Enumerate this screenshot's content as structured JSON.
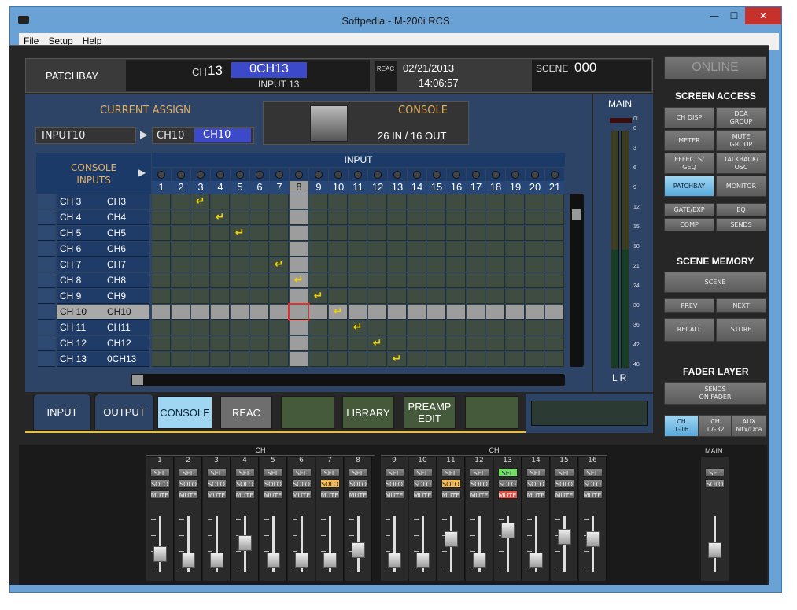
{
  "window": {
    "title": "Softpedia - M-200i RCS",
    "min": "—",
    "max": "☐",
    "close": "✕"
  },
  "menu": [
    "File",
    "Setup",
    "Help"
  ],
  "header": {
    "patchbay": "PATCHBAY",
    "ch_label": "CH",
    "ch_num": "13",
    "ch_name": "0CH13",
    "input_name": "INPUT 13",
    "reac": "REAC",
    "date": "02/21/2013",
    "time": "14:06:57",
    "scene_label": "SCENE",
    "scene_num": "000"
  },
  "assign": {
    "current_assign": "CURRENT ASSIGN",
    "source": "INPUT10",
    "dest_ch": "CH10",
    "dest_name": "CH10",
    "console": "CONSOLE",
    "io": "26 IN / 16 OUT"
  },
  "grid": {
    "row_title": "CONSOLE\nINPUTS",
    "input_title": "INPUT",
    "columns": [
      "1",
      "2",
      "3",
      "4",
      "5",
      "6",
      "7",
      "8",
      "9",
      "10",
      "11",
      "12",
      "13",
      "14",
      "15",
      "16",
      "17",
      "18",
      "19",
      "20",
      "21"
    ],
    "rows": [
      {
        "ch": "CH 3",
        "name": "CH3",
        "patch": 3
      },
      {
        "ch": "CH 4",
        "name": "CH4",
        "patch": 4
      },
      {
        "ch": "CH 5",
        "name": "CH5",
        "patch": 5
      },
      {
        "ch": "CH 6",
        "name": "CH6",
        "patch": 0
      },
      {
        "ch": "CH 7",
        "name": "CH7",
        "patch": 7
      },
      {
        "ch": "CH 8",
        "name": "CH8",
        "patch": 8
      },
      {
        "ch": "CH 9",
        "name": "CH9",
        "patch": 9
      },
      {
        "ch": "CH 10",
        "name": "CH10",
        "patch": 10
      },
      {
        "ch": "CH 11",
        "name": "CH11",
        "patch": 11
      },
      {
        "ch": "CH 12",
        "name": "CH12",
        "patch": 12
      },
      {
        "ch": "CH 13",
        "name": "0CH13",
        "patch": 13
      }
    ],
    "selected_row": "CH 10",
    "selected_col": "8",
    "arrow_glyph": "↵"
  },
  "meter": {
    "title": "MAIN",
    "ol": "0L",
    "scale": [
      "0",
      "3",
      "6",
      "9",
      "12",
      "15",
      "18",
      "21",
      "24",
      "30",
      "36",
      "42",
      "48"
    ],
    "lr": "L R"
  },
  "tabs": [
    "INPUT",
    "OUTPUT",
    "CONSOLE",
    "REAC",
    "",
    "LIBRARY",
    "PREAMP\nEDIT",
    ""
  ],
  "right": {
    "online": "ONLINE",
    "screen_access": "SCREEN ACCESS",
    "access_buttons": [
      "CH DISP",
      "DCA\nGROUP",
      "METER",
      "MUTE\nGROUP",
      "EFFECTS/\nGEQ",
      "TALKBACK/\nOSC",
      "PATCHBAY",
      "MONITOR",
      "GATE/EXP",
      "EQ",
      "COMP",
      "SENDS"
    ],
    "scene_memory": "SCENE MEMORY",
    "scene": "SCENE",
    "prev": "PREV",
    "next": "NEXT",
    "recall": "RECALL",
    "store": "STORE",
    "fader_layer": "FADER LAYER",
    "sends_on_fader": "SENDS\nON FADER",
    "layers": [
      "CH\n1-16",
      "CH\n17-32",
      "AUX\nMtx/Dca"
    ]
  },
  "mixer": {
    "group_label": "CH",
    "main_label": "MAIN",
    "sel": "SEL",
    "solo": "SOLO",
    "mute": "MUTE",
    "channels": [
      {
        "n": "1",
        "fader": 0.2
      },
      {
        "n": "2",
        "fader": 0.05
      },
      {
        "n": "3",
        "fader": 0.05
      },
      {
        "n": "4",
        "fader": 0.45
      },
      {
        "n": "5",
        "fader": 0.05
      },
      {
        "n": "6",
        "fader": 0.05
      },
      {
        "n": "7",
        "fader": 0.05
      },
      {
        "n": "8",
        "fader": 0.3
      },
      {
        "n": "9",
        "fader": 0.05
      },
      {
        "n": "10",
        "fader": 0.05
      },
      {
        "n": "11",
        "fader": 0.55
      },
      {
        "n": "12",
        "fader": 0.05
      },
      {
        "n": "13",
        "fader": 0.75
      },
      {
        "n": "14",
        "fader": 0.05
      },
      {
        "n": "15",
        "fader": 0.6
      },
      {
        "n": "16",
        "fader": 0.55
      }
    ],
    "solo_on": [
      "7",
      "11"
    ],
    "sel_on": [
      "13"
    ],
    "mute_on": [
      "13"
    ],
    "main_fader": 0.3
  },
  "colors": {
    "accent_blue": "#4a7fd6",
    "gold": "#e2b060",
    "arrow": "#f0d000"
  }
}
